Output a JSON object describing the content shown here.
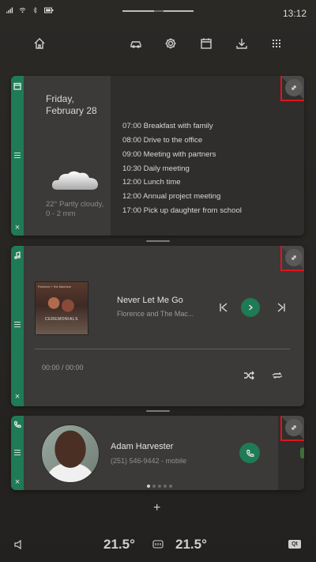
{
  "status": {
    "time": "13:12"
  },
  "calendar": {
    "date_line1": "Friday,",
    "date_line2": "February 28",
    "weather_line1": "22° Partly cloudy,",
    "weather_line2": "0 - 2 mm",
    "events": [
      "07:00 Breakfast with family",
      "08:00 Drive to the office",
      "09:00 Meeting with partners",
      "10:30 Daily meeting",
      "12:00 Lunch time",
      "12:00 Annual project meeting",
      "17:00 Pick up daughter from school"
    ]
  },
  "music": {
    "song": "Never Let Me Go",
    "artist": "Florence and The Mac...",
    "time": "00:00 / 00:00",
    "album_top": "Florence + the Machine",
    "album_title": "CEREMONIALS"
  },
  "contact": {
    "name": "Adam Harvester",
    "phone": "(251) 546-9442 - mobile",
    "page_index": 1,
    "page_count": 5
  },
  "climate": {
    "left_temp": "21.5°",
    "right_temp": "21.5°",
    "qt_label": "Qt"
  },
  "colors": {
    "accent": "#1f7a56",
    "highlight": "#e0141b"
  }
}
